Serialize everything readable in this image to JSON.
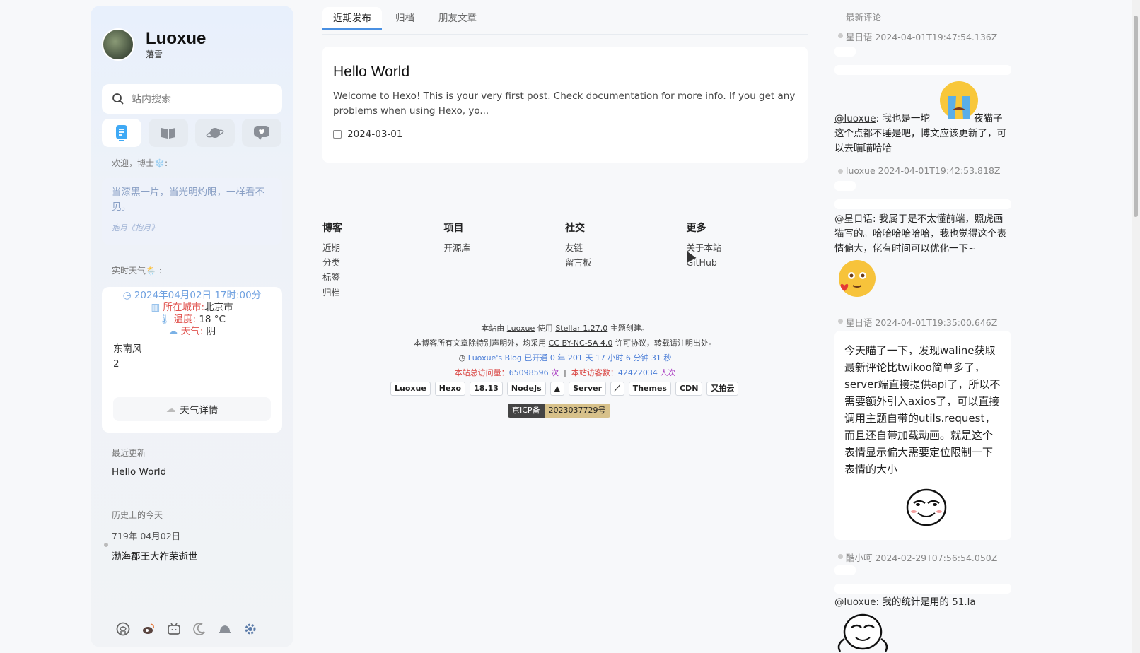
{
  "profile": {
    "name": "Luoxue",
    "subtitle": "落雪"
  },
  "search": {
    "placeholder": "站内搜索"
  },
  "sidebar": {
    "welcome": "欢迎，博士❄️:",
    "quote": "当漆黑一片，当光明灼眼，一样看不见。",
    "quote_source": "抱月《抱月》",
    "weather_label": "实时天气🌦️ :",
    "weather": {
      "datetime": "2024年04月02日 17时:00分",
      "city_label": "所在城市:",
      "city": "北京市",
      "temp_label": "温度:",
      "temp": "18 °C",
      "cond_label": "天气:",
      "cond": "阴",
      "wind": "东南风",
      "wind_level": "2",
      "detail_button": "天气详情"
    },
    "recent_label": "最近更新",
    "recent_item": "Hello World",
    "history_label": "历史上的今天",
    "history_date": "719年  04月02日",
    "history_event": "渤海郡王大祚荣逝世"
  },
  "tabs": [
    "近期发布",
    "归档",
    "朋友文章"
  ],
  "post": {
    "title": "Hello World",
    "excerpt": "Welcome to Hexo! This is your very first post. Check documentation for more info. If you get any problems when using Hexo, yo...",
    "date": "2024-03-01"
  },
  "footer": {
    "cols": [
      {
        "title": "博客",
        "links": [
          "近期",
          "分类",
          "标签",
          "归档"
        ]
      },
      {
        "title": "项目",
        "links": [
          "开源库"
        ]
      },
      {
        "title": "社交",
        "links": [
          "友链",
          "留言板"
        ]
      },
      {
        "title": "更多",
        "links": [
          "关于本站",
          "GitHub"
        ]
      }
    ],
    "credit1_a": "本站由",
    "credit1_author": "Luoxue",
    "credit1_b": "使用",
    "credit1_theme": "Stellar 1.27.0",
    "credit1_c": "主题创建。",
    "credit2_a": "本博客所有文章除特别声明外，均采用",
    "credit2_license": "CC BY-NC-SA 4.0",
    "credit2_b": "许可协议，转载请注明出处。",
    "runtime": "Luoxue's Blog 已开通 0 年 201 天 17 小时 6 分钟 31 秒",
    "pv_label": "本站总访问量：",
    "pv": "65098596",
    "pv_unit": "次",
    "uv_label": "本站访客数：",
    "uv": "42422034",
    "uv_unit": "人次",
    "badges": [
      "Luoxue",
      "Hexo",
      "18.13",
      "NodeJs",
      "▲",
      "Server",
      "⟋",
      "Themes",
      "CDN",
      "又拍云"
    ],
    "icp_label": "京ICP备",
    "icp_num": "2023037729号"
  },
  "comments": {
    "header": "最新评论",
    "c1_meta": "星日语  2024-04-01T19:47:54.136Z",
    "c1_at": "@luoxue",
    "c1_text": ": 我也是一坨",
    "c1_text2": "夜猫子",
    "c1_rest": "这个点都不睡是吧，博文应该更新了，可以去瞄瞄哈哈",
    "c2_meta": "luoxue  2024-04-01T19:42:53.818Z",
    "c2_at": "@星日语",
    "c2_text": ": 我属于是不太懂前端，照虎画猫写的。哈哈哈哈哈哈，我也觉得这个表情偏大，佬有时间可以优化一下~",
    "c3_meta": "星日语  2024-04-01T19:35:00.646Z",
    "c3_text": "今天瞄了一下，发现waline获取最新评论比twikoo简单多了，server端直接提供api了，所以不需要额外引入axios了，可以直接调用主题自带的utils.request，而且还自带加载动画。就是这个表情显示偏大需要定位限制一下表情的大小",
    "c4_meta": "酷小呵  2024-02-29T07:56:54.050Z",
    "c4_at": "@luoxue",
    "c4_text": ": 我的统计是用的",
    "c4_link": "51.la"
  },
  "colors": {
    "accent": "#4a90e2",
    "red": "#e0524d",
    "date_blue": "#6fa1e0"
  }
}
